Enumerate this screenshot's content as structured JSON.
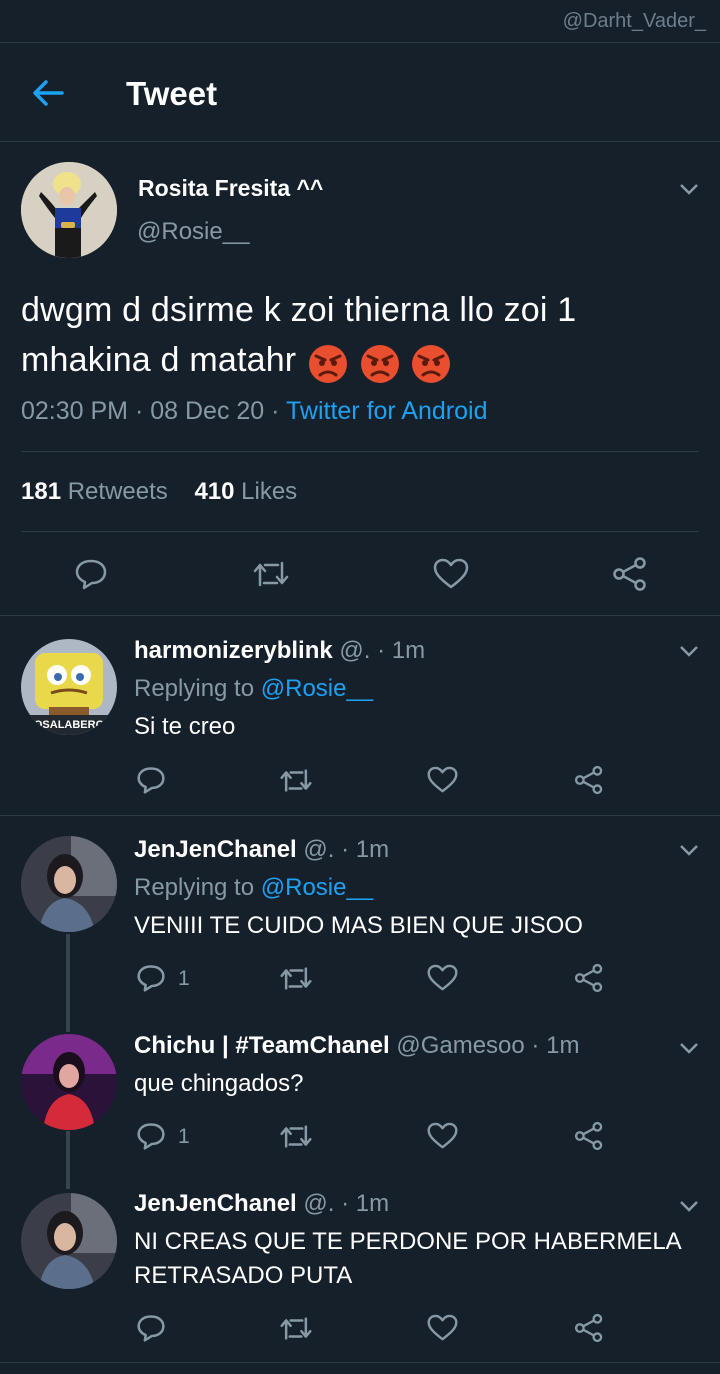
{
  "watermark": "@Darht_Vader_",
  "header": {
    "title": "Tweet"
  },
  "tweet": {
    "author_name": "Rosita Fresita ^^",
    "author_handle": "@Rosie__",
    "text": "dwgm d dsirme k zoi thierna llo zoi   1 mhakina d matahr",
    "time": "02:30 PM",
    "date": "08 Dec 20",
    "source": "Twitter for Android",
    "retweets": "181",
    "retweets_label": "Retweets",
    "likes": "410",
    "likes_label": "Likes"
  },
  "replies": [
    {
      "name": "harmonizeryblink",
      "handle": "@.",
      "time": "1m",
      "replying_label": "Replying to",
      "replying_to": "@Rosie__",
      "text": "Si te creo",
      "reply_count": ""
    },
    {
      "name": "JenJenChanel",
      "handle": "@.",
      "time": "1m",
      "replying_label": "Replying to",
      "replying_to": "@Rosie__",
      "text": "VENIII TE CUIDO MAS BIEN QUE JISOO",
      "reply_count": "1"
    },
    {
      "name": "Chichu | #TeamChanel",
      "handle": "@Gamesoo",
      "time": "1m",
      "text": "que chingados?",
      "reply_count": "1"
    },
    {
      "name": "JenJenChanel",
      "handle": "@.",
      "time": "1m",
      "text_line1": "NI CREAS QUE TE PERDONE POR HABERMELA",
      "text_line2": "RETRASADO PUTA",
      "reply_count": ""
    }
  ],
  "avatar_text": "OSALABERO",
  "separator": "·",
  "colors": {
    "background": "#15202b",
    "accent": "#1da1f2",
    "muted": "#8899a6",
    "border": "#2c3a47"
  }
}
